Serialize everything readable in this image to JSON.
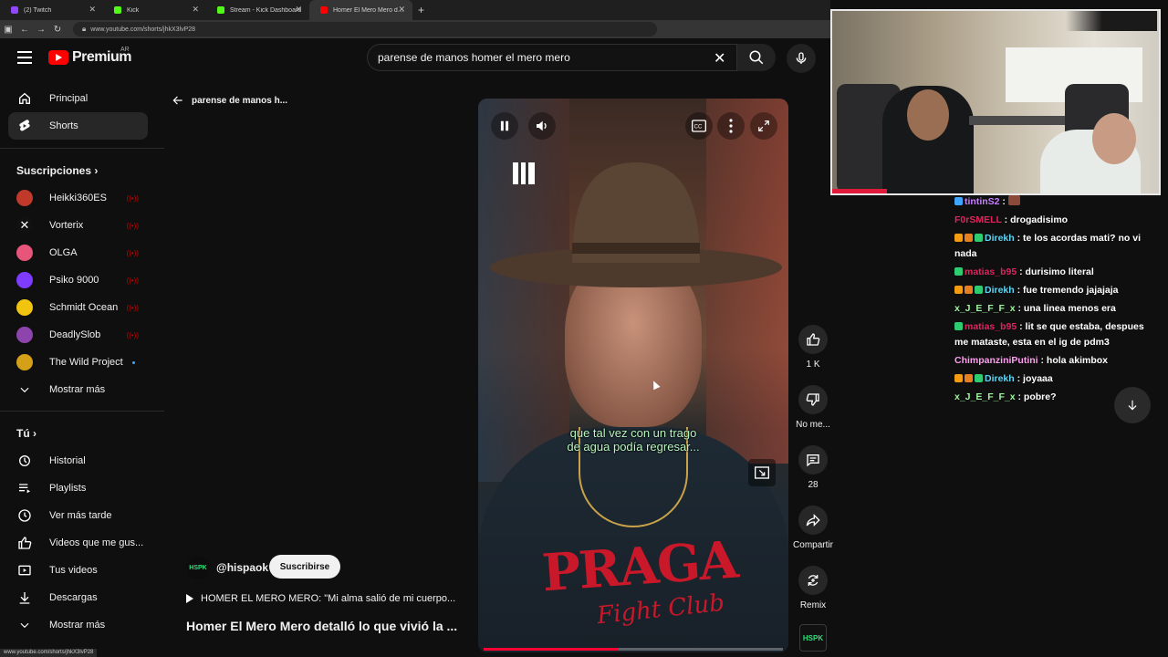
{
  "browser": {
    "tabs": [
      {
        "label": "(2) Twitch",
        "color": "#9146ff"
      },
      {
        "label": "Kick",
        "color": "#53fc18"
      },
      {
        "label": "Stream - Kick Dashboard",
        "color": "#53fc18"
      },
      {
        "label": "Homer El Mero Mero detal",
        "color": "#ff0000"
      }
    ],
    "url": "www.youtube.com/shorts/jhkX3lvP28",
    "status_url": "www.youtube.com/shorts/jhkX3lvP28"
  },
  "header": {
    "brand": "Premium",
    "country": "AR",
    "search_query": "parense de manos homer el mero mero"
  },
  "sidebar": {
    "main": [
      {
        "label": "Principal",
        "icon": "home-icon"
      },
      {
        "label": "Shorts",
        "icon": "shorts-icon"
      }
    ],
    "subscriptions_title": "Suscripciones",
    "subscriptions": [
      {
        "label": "Heikki360ES",
        "color": "#c0392b",
        "status": "live"
      },
      {
        "label": "Vorterix",
        "color": "#111111",
        "status": "live"
      },
      {
        "label": "OLGA",
        "color": "#e8557a",
        "status": "live"
      },
      {
        "label": "Psiko 9000",
        "color": "#7d3cff",
        "status": "live"
      },
      {
        "label": "Schmidt Ocean",
        "color": "#f1c40f",
        "status": "live"
      },
      {
        "label": "DeadlySlob",
        "color": "#8e44ad",
        "status": "live"
      },
      {
        "label": "The Wild Project",
        "color": "#d4a017",
        "status": "new"
      }
    ],
    "more_label": "Mostrar más",
    "you_title": "Tú",
    "you_items": [
      {
        "label": "Historial",
        "icon": "history-icon"
      },
      {
        "label": "Playlists",
        "icon": "playlist-icon"
      },
      {
        "label": "Ver más tarde",
        "icon": "clock-icon"
      },
      {
        "label": "Videos que me gus...",
        "icon": "thumbs-up-icon"
      },
      {
        "label": "Tus videos",
        "icon": "video-icon"
      },
      {
        "label": "Descargas",
        "icon": "download-icon"
      }
    ],
    "more_label_2": "Mostrar más"
  },
  "page": {
    "back_title": "parense de manos h..."
  },
  "player": {
    "subtitle_line1": "que tal vez con un trago",
    "subtitle_line2": "de agua podía regresar...",
    "shirt_text": "PRAGA",
    "shirt_sub": "Fight Club",
    "progress": 0.45
  },
  "actions": {
    "likes": "1 K",
    "dislike_label": "No me...",
    "comments": "28",
    "share_label": "Compartir",
    "remix_label": "Remix",
    "channel_thumb": "HSPK"
  },
  "video": {
    "channel_logo": "HSPK",
    "channel": "@hispaok",
    "subscribe_label": "Suscribirse",
    "related": "HOMER EL MERO MERO: \"Mi alma salió de mi cuerpo...",
    "title": "Homer El Mero Mero detalló lo que vivió la ..."
  },
  "chat": [
    {
      "user": "tintinS2",
      "user_color": "#c77dff",
      "text": "",
      "badges": [
        "#3ea6ff"
      ],
      "emote": true
    },
    {
      "user": "F0rSMELL",
      "user_color": "#e0245e",
      "text": "drogadisimo",
      "badges": []
    },
    {
      "user": "Direkh",
      "user_color": "#5fd3f3",
      "text": "te los acordas mati? no vi nada",
      "badges": [
        "#f39c12",
        "#e67e22",
        "#2ecc71"
      ]
    },
    {
      "user": "matias_b95",
      "user_color": "#e0245e",
      "text": "durisimo literal",
      "badges": [
        "#2ecc71"
      ]
    },
    {
      "user": "Direkh",
      "user_color": "#5fd3f3",
      "text": "fue tremendo jajajaja",
      "badges": [
        "#f39c12",
        "#e67e22",
        "#2ecc71"
      ]
    },
    {
      "user": "x_J_E_F_F_x",
      "user_color": "#9ff59f",
      "text": "una linea menos era",
      "badges": []
    },
    {
      "user": "matias_b95",
      "user_color": "#e0245e",
      "text": "lit se que estaba, despues me mataste, esta en el ig de pdm3",
      "badges": [
        "#2ecc71"
      ]
    },
    {
      "user": "ChimpanziniPutini",
      "user_color": "#ff9ef2",
      "text": "hola akimbox",
      "badges": []
    },
    {
      "user": "Direkh",
      "user_color": "#5fd3f3",
      "text": "joyaaa",
      "badges": [
        "#f39c12",
        "#e67e22",
        "#2ecc71"
      ]
    },
    {
      "user": "x_J_E_F_F_x",
      "user_color": "#9ff59f",
      "text": "pobre?",
      "badges": []
    }
  ]
}
